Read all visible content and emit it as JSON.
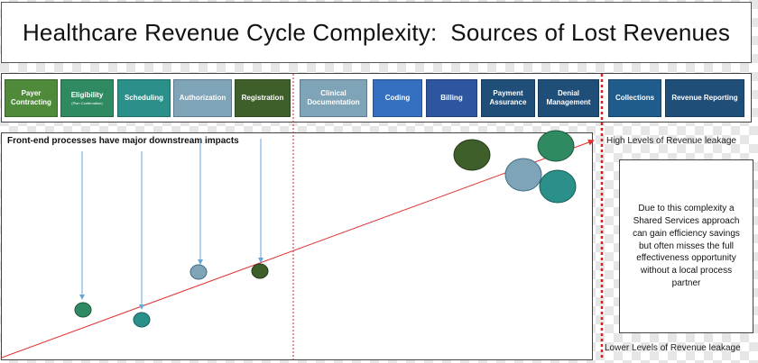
{
  "title": "Healthcare Revenue Cycle Complexity:  Sources of Lost Revenues",
  "steps": [
    {
      "label": "Payer Contracting",
      "sub": "",
      "color": "#4f8a3b"
    },
    {
      "label": "Eligibility",
      "sub": "(Plan Confirmation)",
      "color": "#2f8a62"
    },
    {
      "label": "Scheduling",
      "sub": "",
      "color": "#2b9089"
    },
    {
      "label": "Authorization",
      "sub": "",
      "color": "#7fa3b7"
    },
    {
      "label": "Registration",
      "sub": "",
      "color": "#3e5f2a"
    },
    {
      "label": "Clinical Documentation",
      "sub": "",
      "color": "#7fa3b7"
    },
    {
      "label": "Coding",
      "sub": "",
      "color": "#3470bf"
    },
    {
      "label": "Billing",
      "sub": "",
      "color": "#2e55a0"
    },
    {
      "label": "Payment Assurance",
      "sub": "",
      "color": "#1f4e79"
    },
    {
      "label": "Denial Management",
      "sub": "",
      "color": "#1f4e79"
    },
    {
      "label": "Collections",
      "sub": "",
      "color": "#1f5c8c"
    },
    {
      "label": "Revenue Reporting",
      "sub": "",
      "color": "#1f4e79"
    }
  ],
  "main_note": "Front-end processes have major downstream impacts",
  "high_label": "High Levels of Revenue leakage",
  "low_label": "Lower Levels of Revenue leakage",
  "info_text": "Due to this complexity a Shared Services approach can gain efficiency savings but often misses the full effectiveness opportunity without a local process partner",
  "colors": {
    "trend_line": "#e03030",
    "divider": "#cc2222",
    "arrow": "#6aa6d8"
  }
}
